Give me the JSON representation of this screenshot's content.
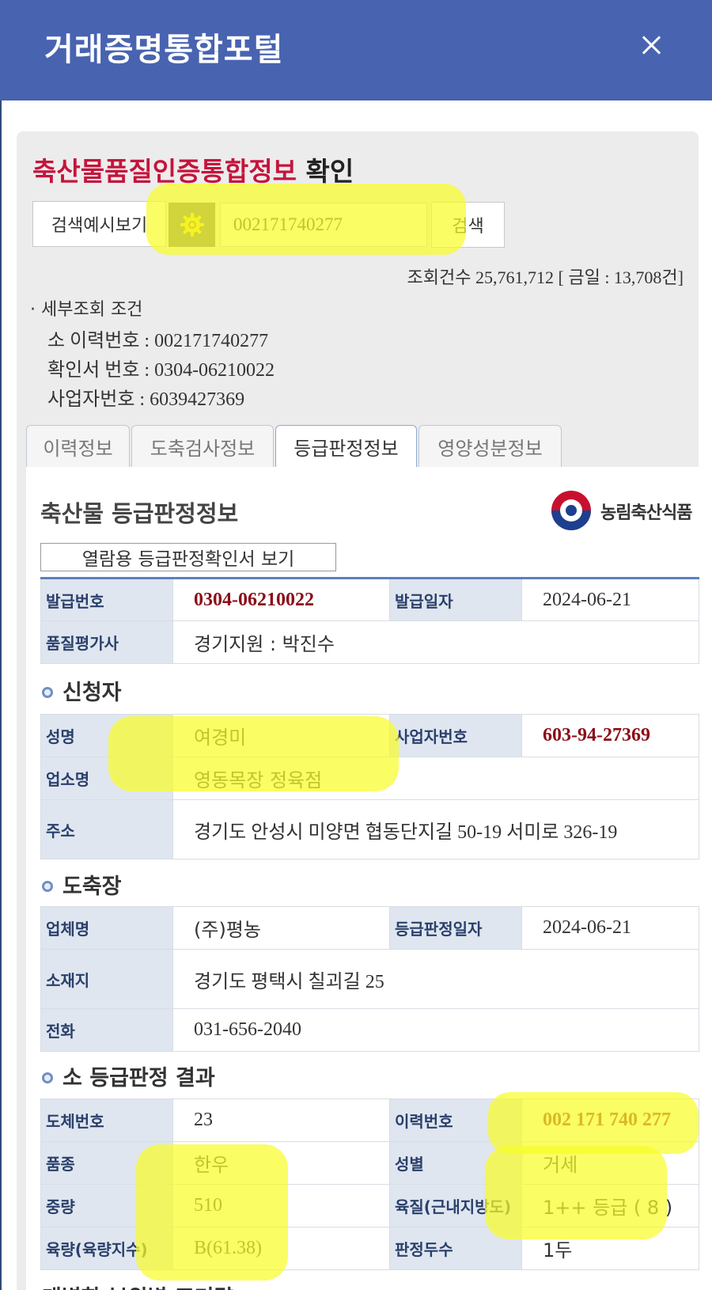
{
  "header": {
    "title": "거래증명통합포털"
  },
  "page": {
    "heading_red": "축산물품질인증통합정보",
    "heading_dark": "확인"
  },
  "search": {
    "example_label": "검색예시보기",
    "value": "002171740277",
    "button_label": "검색"
  },
  "counts": {
    "text": "조회건수 25,761,712 [ 금일 : 13,708건]"
  },
  "conditions": {
    "title": "· 세부조회 조건",
    "items": [
      "소 이력번호 : 002171740277",
      "확인서 번호 : 0304-06210022",
      "사업자번호 : 6039427369"
    ]
  },
  "tabs": [
    {
      "label": "이력정보"
    },
    {
      "label": "도축검사정보"
    },
    {
      "label": "등급판정정보"
    },
    {
      "label": "영양성분정보"
    }
  ],
  "grading": {
    "title": "축산물 등급판정정보",
    "logo_text": "농림축산식품",
    "view_button": "열람용 등급판정확인서 보기",
    "issue": {
      "no_label": "발급번호",
      "no_value": "0304-06210022",
      "date_label": "발급일자",
      "date_value": "2024-06-21",
      "evaluator_label": "품질평가사",
      "evaluator_value": "경기지원 : 박진수"
    },
    "applicant": {
      "title": "신청자",
      "name_label": "성명",
      "name_value": "여경미",
      "biz_label": "사업자번호",
      "biz_value": "603-94-27369",
      "shop_label": "업소명",
      "shop_value": "영동목장 정육점",
      "addr_label": "주소",
      "addr_value": "경기도 안성시 미양면 협동단지길 50-19 서미로 326-19"
    },
    "slaughter": {
      "title": "도축장",
      "company_label": "업체명",
      "company_value": "(주)평농",
      "date_label": "등급판정일자",
      "date_value": "2024-06-21",
      "location_label": "소재지",
      "location_value": "경기도 평택시 칠괴길 25",
      "phone_label": "전화",
      "phone_value": "031-656-2040"
    },
    "result": {
      "title": "소 등급판정 결과",
      "carcass_label": "도체번호",
      "carcass_value": "23",
      "trace_label": "이력번호",
      "trace_value": "002 171 740 277",
      "breed_label": "품종",
      "breed_value": "한우",
      "sex_label": "성별",
      "sex_value": "거세",
      "weight_label": "중량",
      "weight_value": "510",
      "quality_label": "육질(근내지방도)",
      "quality_value": "1++ 등급 ( 8 )",
      "yield_label": "육량(육량지수)",
      "yield_value": "B(61.38)",
      "heads_label": "판정두수",
      "heads_value": "1두"
    },
    "next_section_partial": "개별한 부위별 표기량"
  },
  "colors": {
    "header_bg": "#4863b0",
    "heading_red": "#c5143c",
    "accent_value": "#8b0d18",
    "highlight": "#f8fc28"
  }
}
